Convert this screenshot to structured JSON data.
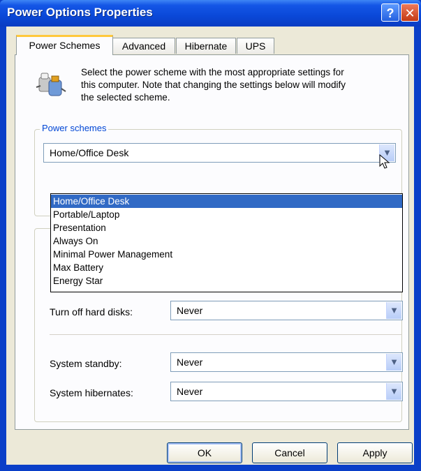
{
  "window": {
    "title": "Power Options Properties"
  },
  "titlebar": {
    "help_label": "?",
    "close_label": "✕"
  },
  "tabs": [
    {
      "label": "Power Schemes",
      "active": true
    },
    {
      "label": "Advanced",
      "active": false
    },
    {
      "label": "Hibernate",
      "active": false
    },
    {
      "label": "UPS",
      "active": false
    }
  ],
  "intro": {
    "text_line1": "Select the power scheme with the most appropriate settings for",
    "text_line2": "this computer. Note that changing the settings below will modify",
    "text_line3": "the selected scheme."
  },
  "power_schemes": {
    "legend": "Power schemes",
    "selected": "Home/Office Desk",
    "options": [
      "Home/Office Desk",
      "Portable/Laptop",
      "Presentation",
      "Always On",
      "Minimal Power Management",
      "Max Battery",
      "Energy Star"
    ]
  },
  "settings": {
    "hard_disks": {
      "label": "Turn off hard disks:",
      "value": "Never"
    },
    "standby": {
      "label": "System standby:",
      "value": "Never"
    },
    "hibernates": {
      "label": "System hibernates:",
      "value": "Never"
    }
  },
  "buttons": {
    "ok": "OK",
    "cancel": "Cancel",
    "apply": "Apply"
  },
  "icons": {
    "dropdown_arrow": "▼"
  },
  "colors": {
    "selection": "#316ac5",
    "legend": "#0046d5",
    "titlebar": "#0a48d8"
  }
}
